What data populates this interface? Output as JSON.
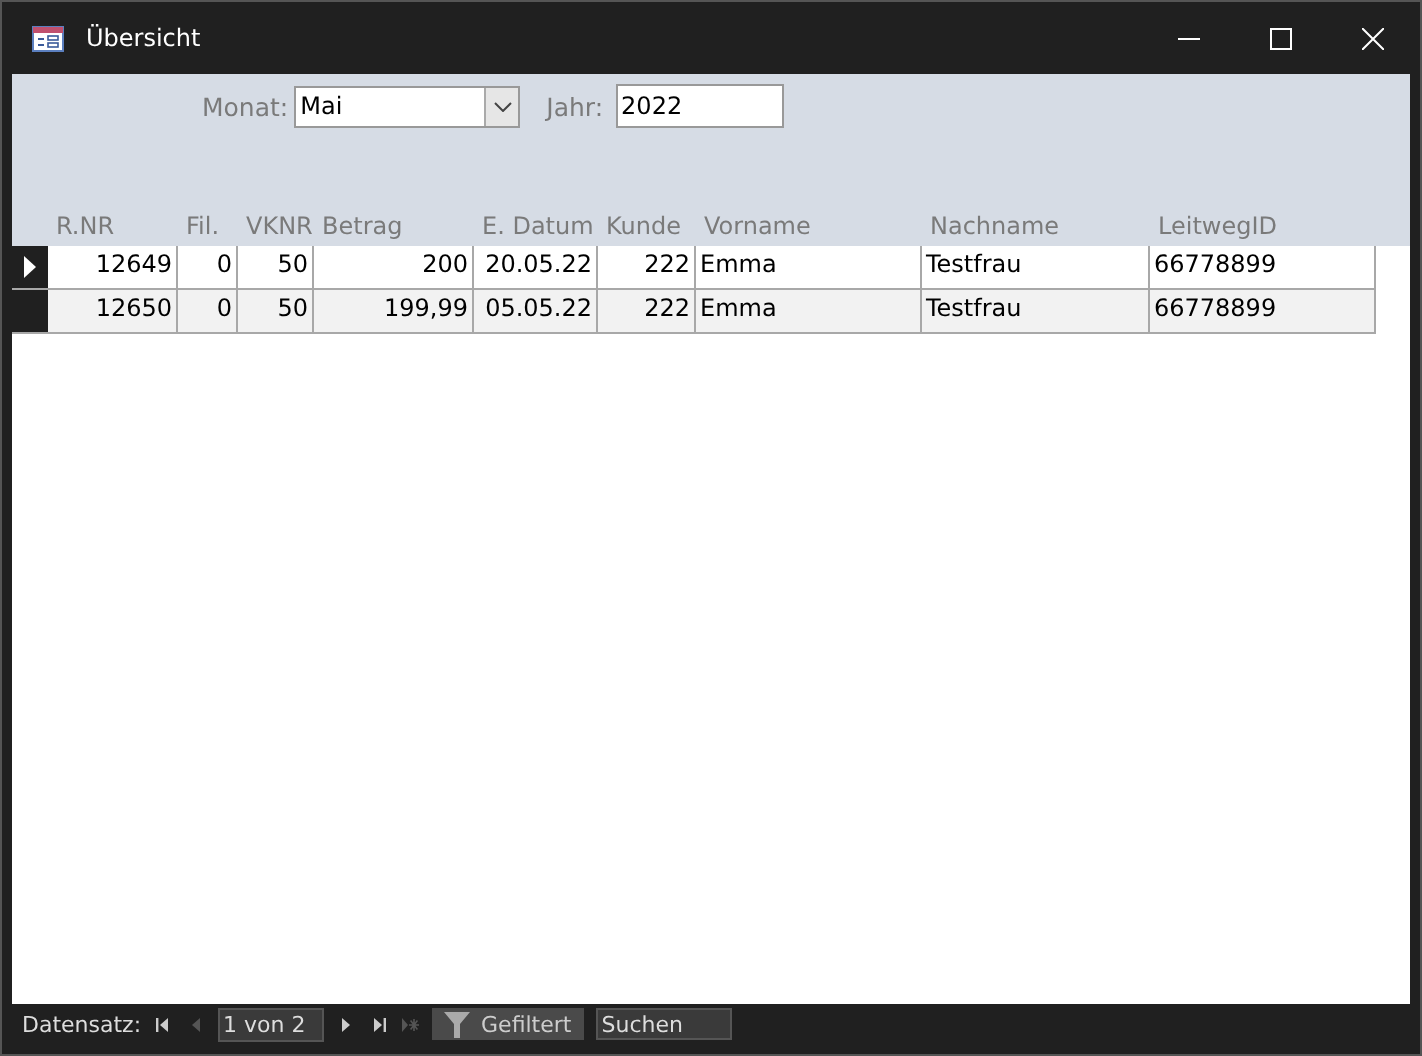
{
  "window": {
    "title": "Übersicht"
  },
  "filters": [
    {
      "label": "Monat:",
      "value": "Mai",
      "kind": "dropdown"
    },
    {
      "label": "Jahr:",
      "value": "2022",
      "kind": "text"
    }
  ],
  "table": {
    "columns": [
      {
        "label": "R.NR",
        "kind": "number"
      },
      {
        "label": "Fil.",
        "kind": "number"
      },
      {
        "label": "VKNR",
        "kind": "number"
      },
      {
        "label": "Betrag",
        "kind": "number"
      },
      {
        "label": "E. Datum",
        "kind": "number"
      },
      {
        "label": "Kunde",
        "kind": "number"
      },
      {
        "label": "Vorname",
        "kind": "text"
      },
      {
        "label": "Nachname",
        "kind": "text"
      },
      {
        "label": "LeitwegID",
        "kind": "text"
      }
    ],
    "rows": [
      {
        "selected": true,
        "cells": [
          "12649",
          "0",
          "50",
          "200",
          "20.05.22",
          "222",
          "Emma",
          "Testfrau",
          "66778899"
        ]
      },
      {
        "selected": false,
        "cells": [
          "12650",
          "0",
          "50",
          "199,99",
          "05.05.22",
          "222",
          "Emma",
          "Testfrau",
          "66778899"
        ]
      }
    ]
  },
  "navigation": {
    "label": "Datensatz:",
    "buttons": [
      {
        "kind": "first",
        "disabled": false
      },
      {
        "kind": "prev",
        "disabled": true
      }
    ],
    "position": "1 von 2",
    "buttons_after": [
      {
        "kind": "next",
        "disabled": false
      },
      {
        "kind": "last",
        "disabled": false
      },
      {
        "kind": "new",
        "disabled": true
      }
    ],
    "filter": "Gefiltert",
    "search": {
      "placeholder": "Suchen"
    }
  }
}
